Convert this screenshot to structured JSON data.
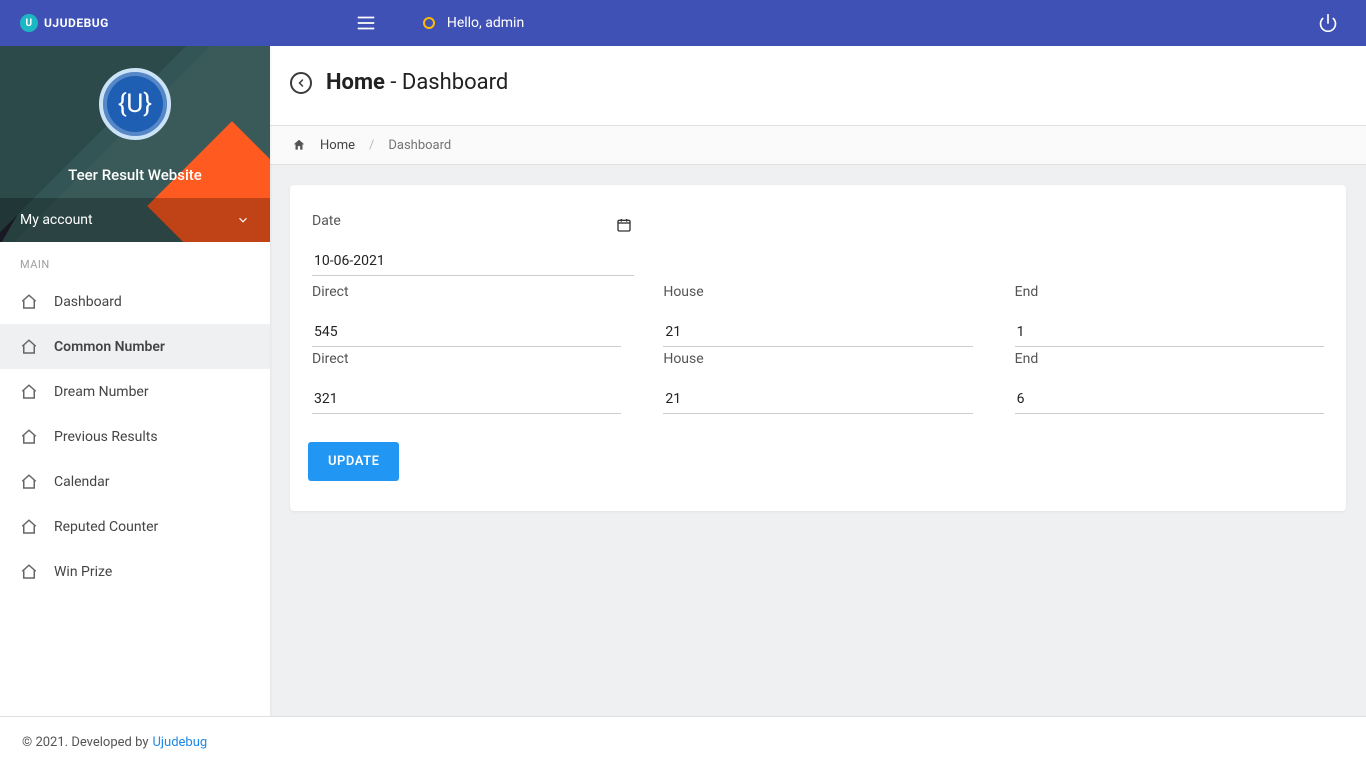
{
  "brand": {
    "name": "UJUDEBUG"
  },
  "header": {
    "greeting": "Hello, admin"
  },
  "sidebar": {
    "site_title": "Teer Result Website",
    "my_account_label": "My account",
    "section_label": "MAIN",
    "items": [
      {
        "label": "Dashboard"
      },
      {
        "label": "Common Number"
      },
      {
        "label": "Dream Number"
      },
      {
        "label": "Previous Results"
      },
      {
        "label": "Calendar"
      },
      {
        "label": "Reputed Counter"
      },
      {
        "label": "Win Prize"
      }
    ]
  },
  "page": {
    "title_bold": "Home",
    "title_rest": " - Dashboard",
    "breadcrumb": {
      "home": "Home",
      "current": "Dashboard"
    }
  },
  "form": {
    "date_label": "Date",
    "date_value": "10-06-2021",
    "rows": [
      {
        "direct_label": "Direct",
        "direct": "545",
        "house_label": "House",
        "house": "21",
        "end_label": "End",
        "end": "1"
      },
      {
        "direct_label": "Direct",
        "direct": "321",
        "house_label": "House",
        "house": "21",
        "end_label": "End",
        "end": "6"
      }
    ],
    "submit_label": "UPDATE"
  },
  "footer": {
    "text": "© 2021. Developed by",
    "link": "Ujudebug"
  }
}
